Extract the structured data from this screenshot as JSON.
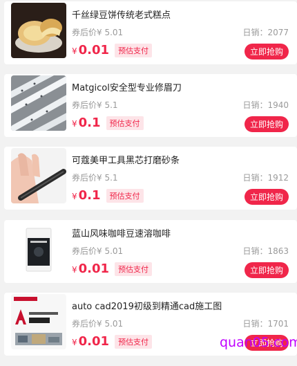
{
  "products": [
    {
      "title": "千丝绿豆饼传统老式糕点",
      "coupon_label": "券后价",
      "coupon_price": "¥ 5.01",
      "sales_label": "日销：",
      "sales": "2077",
      "yen": "¥",
      "price": "0.01",
      "tag": "预估支付",
      "button": "立即抢购",
      "image": "mung-bean-cake-image"
    },
    {
      "title": "Matgicol安全型专业修眉刀",
      "coupon_label": "券后价",
      "coupon_price": "¥ 5.1",
      "sales_label": "日销：",
      "sales": "1940",
      "yen": "¥",
      "price": "0.1",
      "tag": "预估支付",
      "button": "立即抢购",
      "image": "eyebrow-razor-image"
    },
    {
      "title": "可蔻美甲工具黑芯打磨砂条",
      "coupon_label": "券后价",
      "coupon_price": "¥ 5.1",
      "sales_label": "日销：",
      "sales": "1912",
      "yen": "¥",
      "price": "0.1",
      "tag": "预估支付",
      "button": "立即抢购",
      "image": "nail-file-image"
    },
    {
      "title": "蓝山风味咖啡豆速溶咖啡",
      "coupon_label": "券后价",
      "coupon_price": "¥ 5.01",
      "sales_label": "日销：",
      "sales": "1863",
      "yen": "¥",
      "price": "0.01",
      "tag": "预估支付",
      "button": "立即抢购",
      "image": "coffee-bag-image"
    },
    {
      "title": "auto cad2019初级到精通cad施工图",
      "coupon_label": "券后价",
      "coupon_price": "¥ 5.01",
      "sales_label": "日销：",
      "sales": "1701",
      "yen": "¥",
      "price": "0.01",
      "tag": "预估支付",
      "button": "立即抢购",
      "image": "cad-course-image"
    }
  ],
  "watermark": "quan05.com",
  "colors": {
    "accent": "#f0264a",
    "background": "#f2f2f2",
    "card": "#ffffff"
  }
}
